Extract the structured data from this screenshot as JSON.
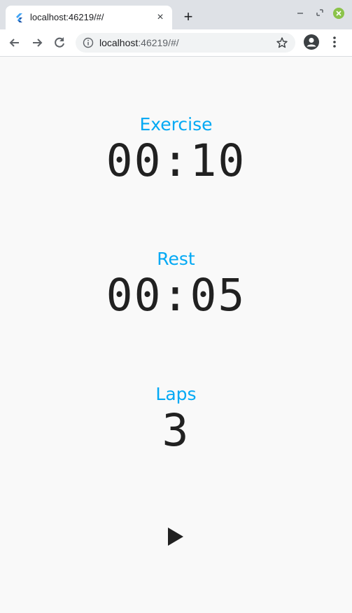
{
  "browser": {
    "tab_title": "localhost:46219/#/",
    "tab_close": "×",
    "new_tab": "+",
    "url_host": "localhost",
    "url_rest": ":46219/#/"
  },
  "app": {
    "exercise": {
      "label": "Exercise",
      "value": "00:10"
    },
    "rest": {
      "label": "Rest",
      "value": "00:05"
    },
    "laps": {
      "label": "Laps",
      "value": "3"
    },
    "play_icon": "play-icon"
  },
  "colors": {
    "accent": "#03a9f4",
    "text": "#212121",
    "background": "#f9f9f9"
  }
}
